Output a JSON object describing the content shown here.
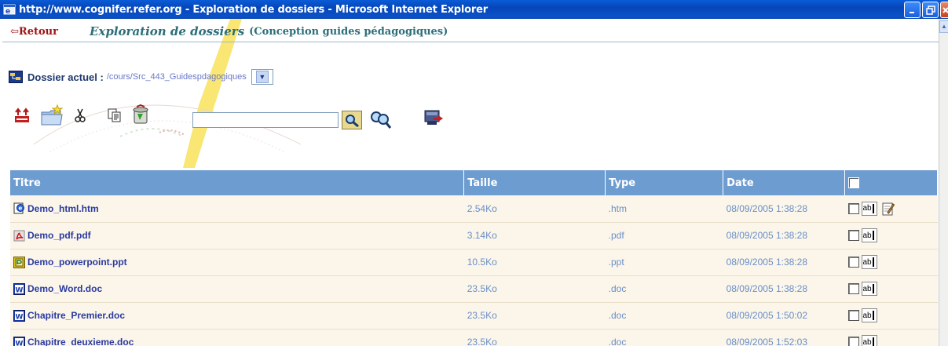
{
  "window": {
    "title": "http://www.cognifer.refer.org - Exploration de dossiers - Microsoft Internet Explorer"
  },
  "nav": {
    "back_label": "Retour",
    "heading": "Exploration de dossiers",
    "subheading": "(Conception guides pédagogiques)"
  },
  "folder": {
    "label": "Dossier actuel :",
    "path": "/cours/Src_443_Guidespdagogiques"
  },
  "search": {
    "value": ""
  },
  "table": {
    "headers": {
      "title": "Titre",
      "size": "Taille",
      "type": "Type",
      "date": "Date"
    },
    "rows": [
      {
        "name": "Demo_html.htm",
        "size": "2.54Ko",
        "type": ".htm",
        "date": "08/09/2005 1:38:28",
        "icon": "html-file-icon",
        "editable": true
      },
      {
        "name": "Demo_pdf.pdf",
        "size": "3.14Ko",
        "type": ".pdf",
        "date": "08/09/2005 1:38:28",
        "icon": "pdf-file-icon",
        "editable": false
      },
      {
        "name": "Demo_powerpoint.ppt",
        "size": "10.5Ko",
        "type": ".ppt",
        "date": "08/09/2005 1:38:28",
        "icon": "powerpoint-file-icon",
        "editable": false
      },
      {
        "name": "Demo_Word.doc",
        "size": "23.5Ko",
        "type": ".doc",
        "date": "08/09/2005 1:38:28",
        "icon": "word-file-icon",
        "editable": false
      },
      {
        "name": "Chapitre_Premier.doc",
        "size": "23.5Ko",
        "type": ".doc",
        "date": "08/09/2005 1:50:02",
        "icon": "word-file-icon",
        "editable": false
      },
      {
        "name": "Chapitre_deuxieme.doc",
        "size": "23.5Ko",
        "type": ".doc",
        "date": "08/09/2005 1:52:03",
        "icon": "word-file-icon",
        "editable": false
      }
    ]
  },
  "rename_label": "ab",
  "colors": {
    "titlebar": "#0a52c9",
    "table_header": "#6d9cd0",
    "row_bg": "#fbf6e9",
    "filename": "#2a3aa0",
    "meta": "#6a8ec8",
    "back_link": "#a01414",
    "heading": "#2c6e7a"
  }
}
